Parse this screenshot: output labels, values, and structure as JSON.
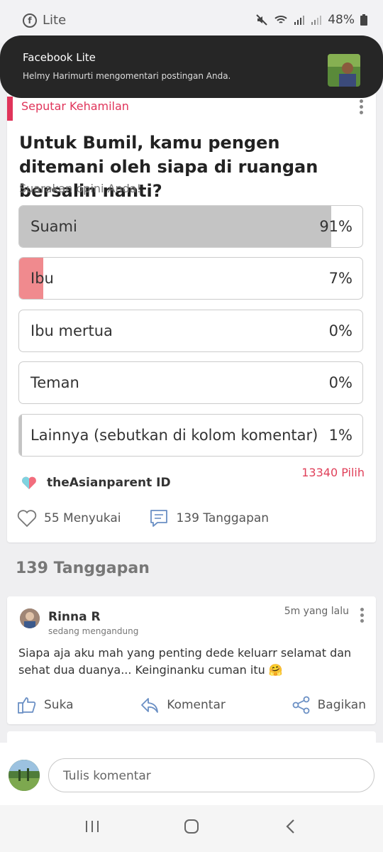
{
  "status_bar": {
    "app_label": "Lite",
    "battery": "48%"
  },
  "notification": {
    "app": "Facebook Lite",
    "text": "Helmy Harimurti mengomentari postingan Anda."
  },
  "poll": {
    "category": "Seputar Kehamilan",
    "question": "Untuk Bumil, kamu pengen ditemani oleh siapa di ruangan bersalin nanti?",
    "subtitle": "Suarakan opini Anda!",
    "options": [
      {
        "label": "Suami",
        "percent": "91%",
        "fraction": 0.91,
        "fill_color": "#c4c4c4"
      },
      {
        "label": "Ibu",
        "percent": "7%",
        "fraction": 0.07,
        "fill_color": "#f08a8e"
      },
      {
        "label": "Ibu mertua",
        "percent": "0%",
        "fraction": 0.0,
        "fill_color": "#c4c4c4"
      },
      {
        "label": "Teman",
        "percent": "0%",
        "fraction": 0.0,
        "fill_color": "#c4c4c4"
      },
      {
        "label": "Lainnya (sebutkan di kolom komentar)",
        "percent": "1%",
        "fraction": 0.01,
        "fill_color": "#c4c4c4"
      }
    ],
    "votes": "13340 Pilih",
    "author": "theAsianparent ID",
    "likes": "55 Menyukai",
    "responses": "139 Tanggapan"
  },
  "responses_header": "139 Tanggapan",
  "comment": {
    "name": "Rinna R",
    "status": "sedang mengandung",
    "time": "5m yang lalu",
    "text": "Siapa aja aku mah yang penting dede keluarr selamat dan sehat dua duanya... Keinginanku cuman itu",
    "emoji": "🤗",
    "like_label": "Suka",
    "comment_label": "Komentar",
    "share_label": "Bagikan"
  },
  "composer": {
    "placeholder": "Tulis komentar"
  },
  "colors": {
    "accent": "#e0345a",
    "votes": "#e0405a"
  }
}
